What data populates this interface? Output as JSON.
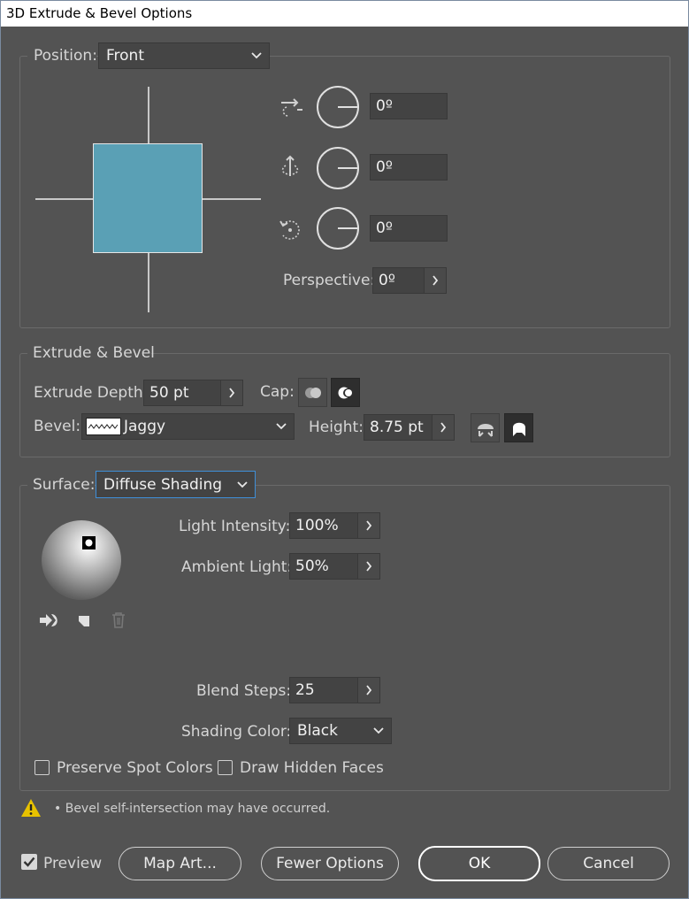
{
  "window": {
    "title": "3D Extrude & Bevel Options"
  },
  "position": {
    "label": "Position:",
    "value": "Front",
    "x_rotation": "0º",
    "y_rotation": "0º",
    "z_rotation": "0º",
    "perspective_label": "Perspective:",
    "perspective_value": "0º"
  },
  "extrude": {
    "section_title": "Extrude & Bevel",
    "depth_label": "Extrude Depth:",
    "depth_value": "50 pt",
    "cap_label": "Cap:",
    "bevel_label": "Bevel:",
    "bevel_value": "Jaggy",
    "height_label": "Height:",
    "height_value": "8.75 pt"
  },
  "surface": {
    "label": "Surface:",
    "value": "Diffuse Shading",
    "light_intensity_label": "Light Intensity:",
    "light_intensity_value": "100%",
    "ambient_light_label": "Ambient Light:",
    "ambient_light_value": "50%",
    "blend_steps_label": "Blend Steps:",
    "blend_steps_value": "25",
    "shading_color_label": "Shading Color:",
    "shading_color_value": "Black",
    "preserve_spot_label": "Preserve Spot Colors",
    "draw_hidden_label": "Draw Hidden Faces"
  },
  "warning": {
    "text": "• Bevel self-intersection may have occurred."
  },
  "footer": {
    "preview_label": "Preview",
    "preview_checked": true,
    "map_art": "Map Art...",
    "fewer_options": "Fewer Options",
    "ok": "OK",
    "cancel": "Cancel"
  },
  "icons": [
    "rotate-x-icon",
    "rotate-y-icon",
    "rotate-z-icon",
    "cap-off-icon",
    "cap-on-icon",
    "bevel-out-icon",
    "bevel-in-icon",
    "move-light-back-icon",
    "new-light-icon",
    "delete-light-icon",
    "warning-icon"
  ],
  "colors": {
    "background": "#535353",
    "cube_face": "#5aa0b5",
    "warning": "#e8c200"
  }
}
